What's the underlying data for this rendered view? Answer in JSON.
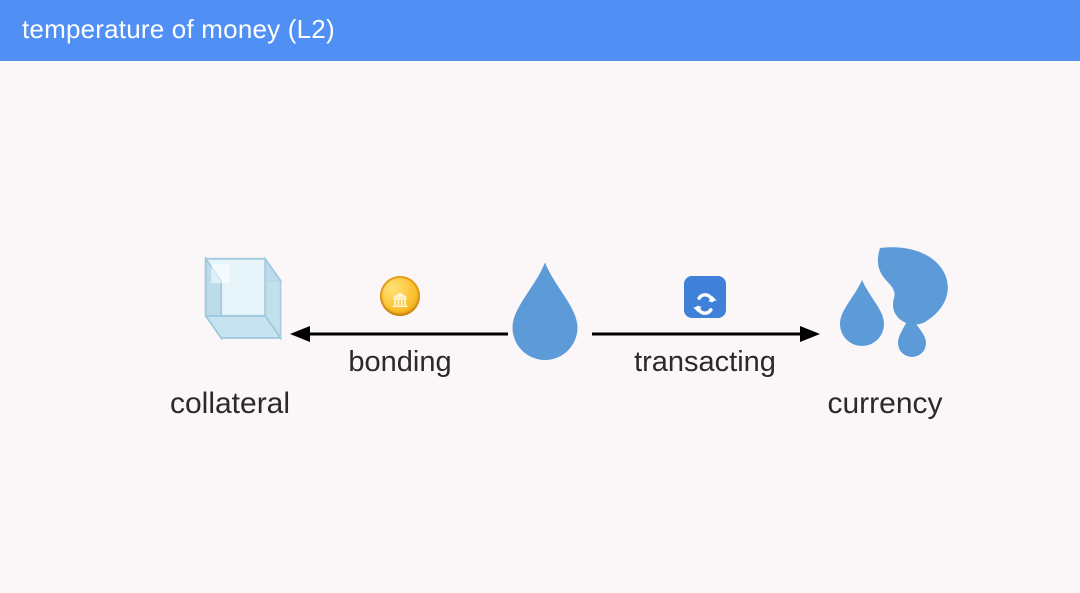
{
  "title": "temperature of money (L2)",
  "nodes": {
    "left": {
      "label": "collateral",
      "icon": "ice-cube"
    },
    "mid": {
      "icon": "water-drop"
    },
    "right": {
      "label": "currency",
      "icon": "water-splash"
    }
  },
  "arrows": {
    "left": {
      "label": "bonding",
      "icon": "bank-coin"
    },
    "right": {
      "label": "transacting",
      "icon": "swap"
    }
  },
  "colors": {
    "header": "#508ff4",
    "blue": "#5c9bd8",
    "coin": "#fbbf2c"
  }
}
